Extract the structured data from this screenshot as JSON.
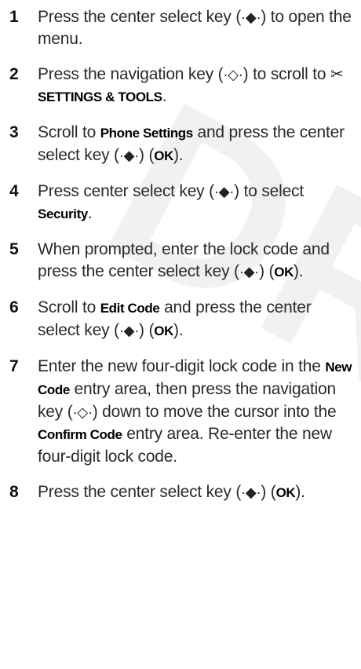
{
  "watermark": "DRAFT",
  "steps": [
    {
      "number": "1",
      "parts": [
        {
          "text": "Press the center select key ("
        },
        {
          "icon": "center-select-key",
          "glyph": "·◆·"
        },
        {
          "text": ") to open the menu."
        }
      ]
    },
    {
      "number": "2",
      "parts": [
        {
          "text": "Press the navigation key ("
        },
        {
          "icon": "navigation-key",
          "glyph": "·◇·"
        },
        {
          "text": ") to scroll to "
        },
        {
          "icon": "settings-tools",
          "glyph": "✂"
        },
        {
          "text": "SETTINGS & TOOLS",
          "term": true
        },
        {
          "text": "."
        }
      ]
    },
    {
      "number": "3",
      "parts": [
        {
          "text": "Scroll to "
        },
        {
          "text": "Phone Settings",
          "term": true
        },
        {
          "text": " and press the center select key ("
        },
        {
          "icon": "center-select-key",
          "glyph": "·◆·"
        },
        {
          "text": ") ("
        },
        {
          "text": "OK",
          "term": true
        },
        {
          "text": ")."
        }
      ]
    },
    {
      "number": "4",
      "parts": [
        {
          "text": "Press center select key ("
        },
        {
          "icon": "center-select-key",
          "glyph": "·◆·"
        },
        {
          "text": ") to select "
        },
        {
          "text": "Security",
          "term": true
        },
        {
          "text": "."
        }
      ]
    },
    {
      "number": "5",
      "parts": [
        {
          "text": "When prompted, enter the lock code and press the center select key ("
        },
        {
          "icon": "center-select-key",
          "glyph": "·◆·"
        },
        {
          "text": ") ("
        },
        {
          "text": "OK",
          "term": true
        },
        {
          "text": ")."
        }
      ]
    },
    {
      "number": "6",
      "parts": [
        {
          "text": "Scroll to "
        },
        {
          "text": "Edit Code",
          "term": true
        },
        {
          "text": " and press the center select key ("
        },
        {
          "icon": "center-select-key",
          "glyph": "·◆·"
        },
        {
          "text": ") ("
        },
        {
          "text": "OK",
          "term": true
        },
        {
          "text": ")."
        }
      ]
    },
    {
      "number": "7",
      "parts": [
        {
          "text": "Enter the new four-digit lock code in the "
        },
        {
          "text": "New Code",
          "term": true
        },
        {
          "text": " entry area, then press the navigation key ("
        },
        {
          "icon": "navigation-key",
          "glyph": "·◇·"
        },
        {
          "text": ") down to move the cursor into the "
        },
        {
          "text": "Confirm Code",
          "term": true
        },
        {
          "text": " entry area. Re-enter the new four-digit lock code."
        }
      ]
    },
    {
      "number": "8",
      "parts": [
        {
          "text": "Press the center select key ("
        },
        {
          "icon": "center-select-key",
          "glyph": "·◆·"
        },
        {
          "text": ") ("
        },
        {
          "text": "OK",
          "term": true
        },
        {
          "text": ")."
        }
      ]
    }
  ]
}
